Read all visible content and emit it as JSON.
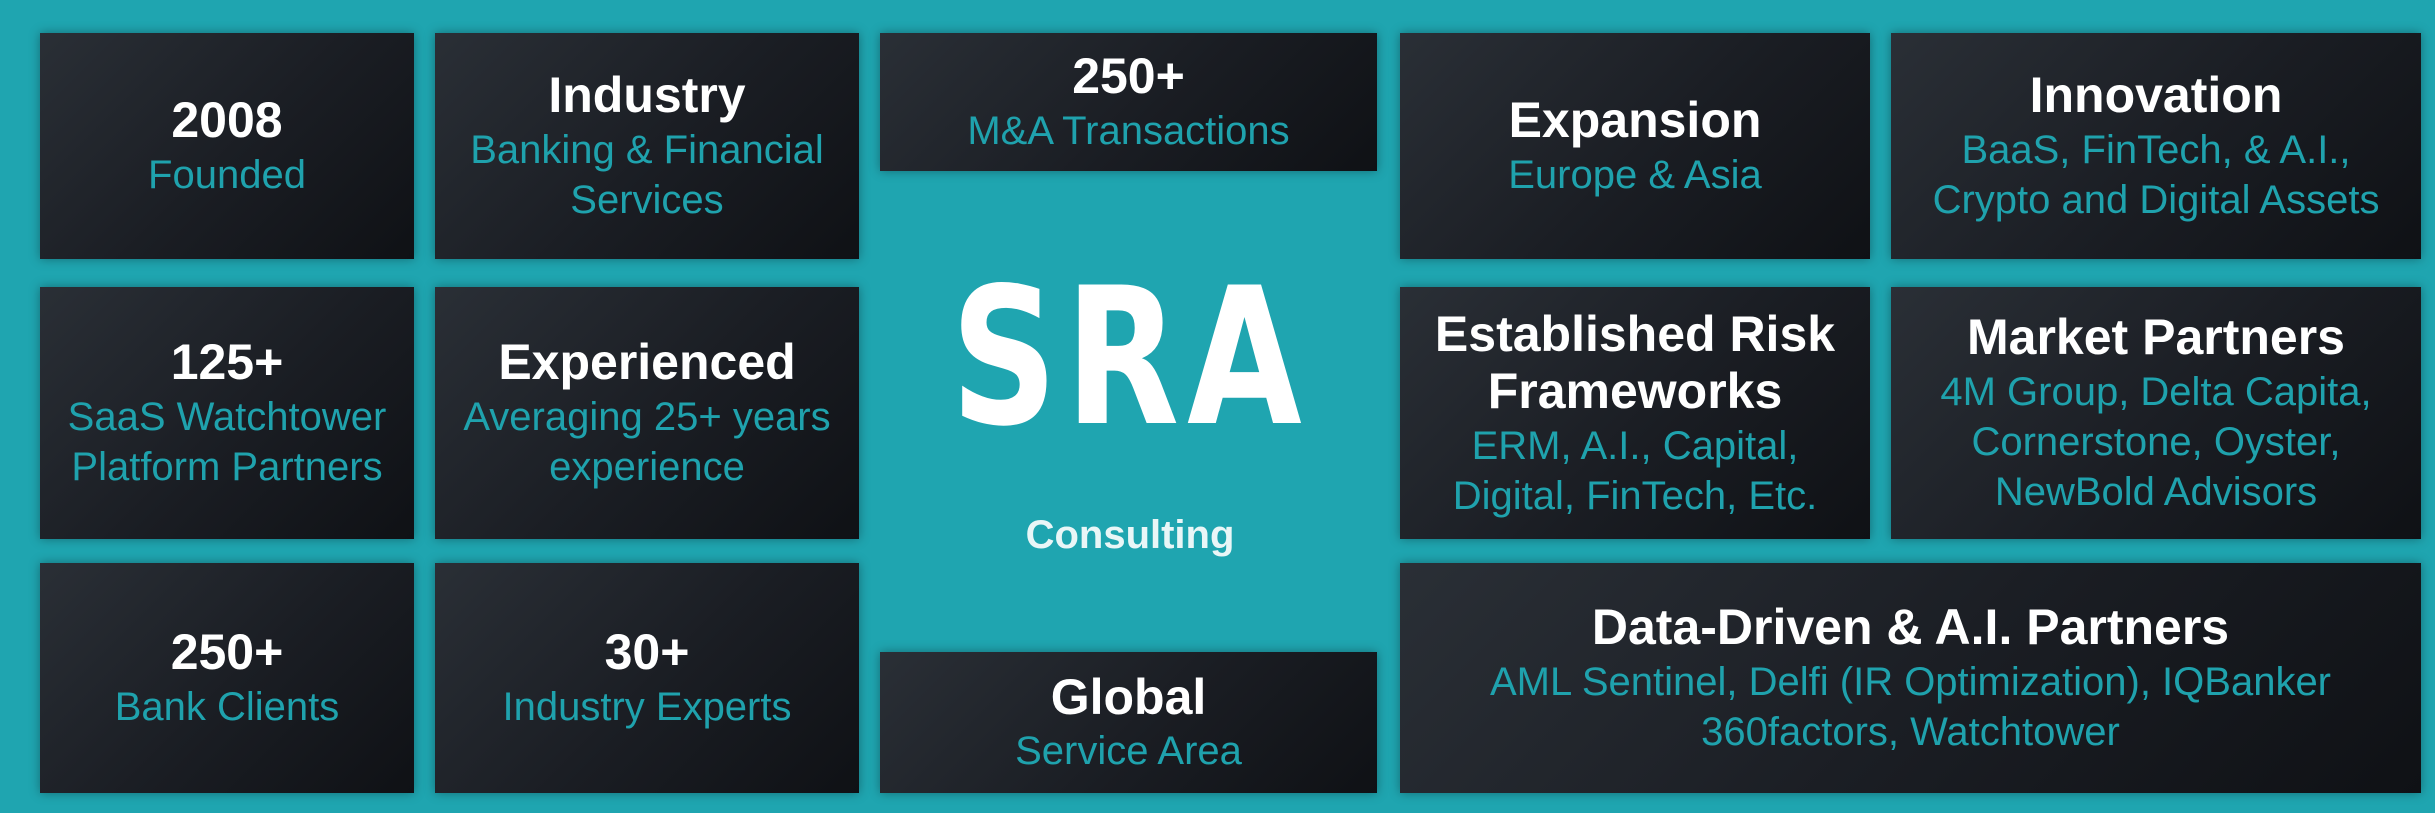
{
  "logo": {
    "main": "SRA",
    "sub": "Consulting"
  },
  "tiles": {
    "founded": {
      "title": "2008",
      "lines": [
        "Founded"
      ]
    },
    "industry": {
      "title": "Industry",
      "lines": [
        "Banking & Financial",
        "Services"
      ]
    },
    "ma": {
      "title": "250+",
      "lines": [
        "M&A Transactions"
      ]
    },
    "expansion": {
      "title": "Expansion",
      "lines": [
        "Europe & Asia"
      ]
    },
    "innovation": {
      "title": "Innovation",
      "lines": [
        "BaaS, FinTech, &  A.I.,",
        "Crypto and Digital Assets"
      ]
    },
    "saas": {
      "title": "125+",
      "lines": [
        "SaaS Watchtower",
        "Platform Partners"
      ]
    },
    "experienced": {
      "title": "Experienced",
      "lines": [
        "Averaging 25+ years",
        "experience"
      ]
    },
    "risk": {
      "title_lines": [
        "Established Risk",
        "Frameworks"
      ],
      "lines": [
        "ERM, A.I., Capital,",
        "Digital,  FinTech, Etc."
      ]
    },
    "market": {
      "title": "Market Partners",
      "lines": [
        "4M Group, Delta Capita,",
        "Cornerstone, Oyster,",
        "NewBold Advisors"
      ]
    },
    "bank": {
      "title": "250+",
      "lines": [
        "Bank Clients"
      ]
    },
    "experts": {
      "title": "30+",
      "lines": [
        "Industry Experts"
      ]
    },
    "global": {
      "title": "Global",
      "lines": [
        "Service Area"
      ]
    },
    "data": {
      "title": "Data-Driven & A.I. Partners",
      "lines": [
        "AML Sentinel, Delfi (IR Optimization), IQBanker",
        "360factors, Watchtower"
      ]
    }
  }
}
